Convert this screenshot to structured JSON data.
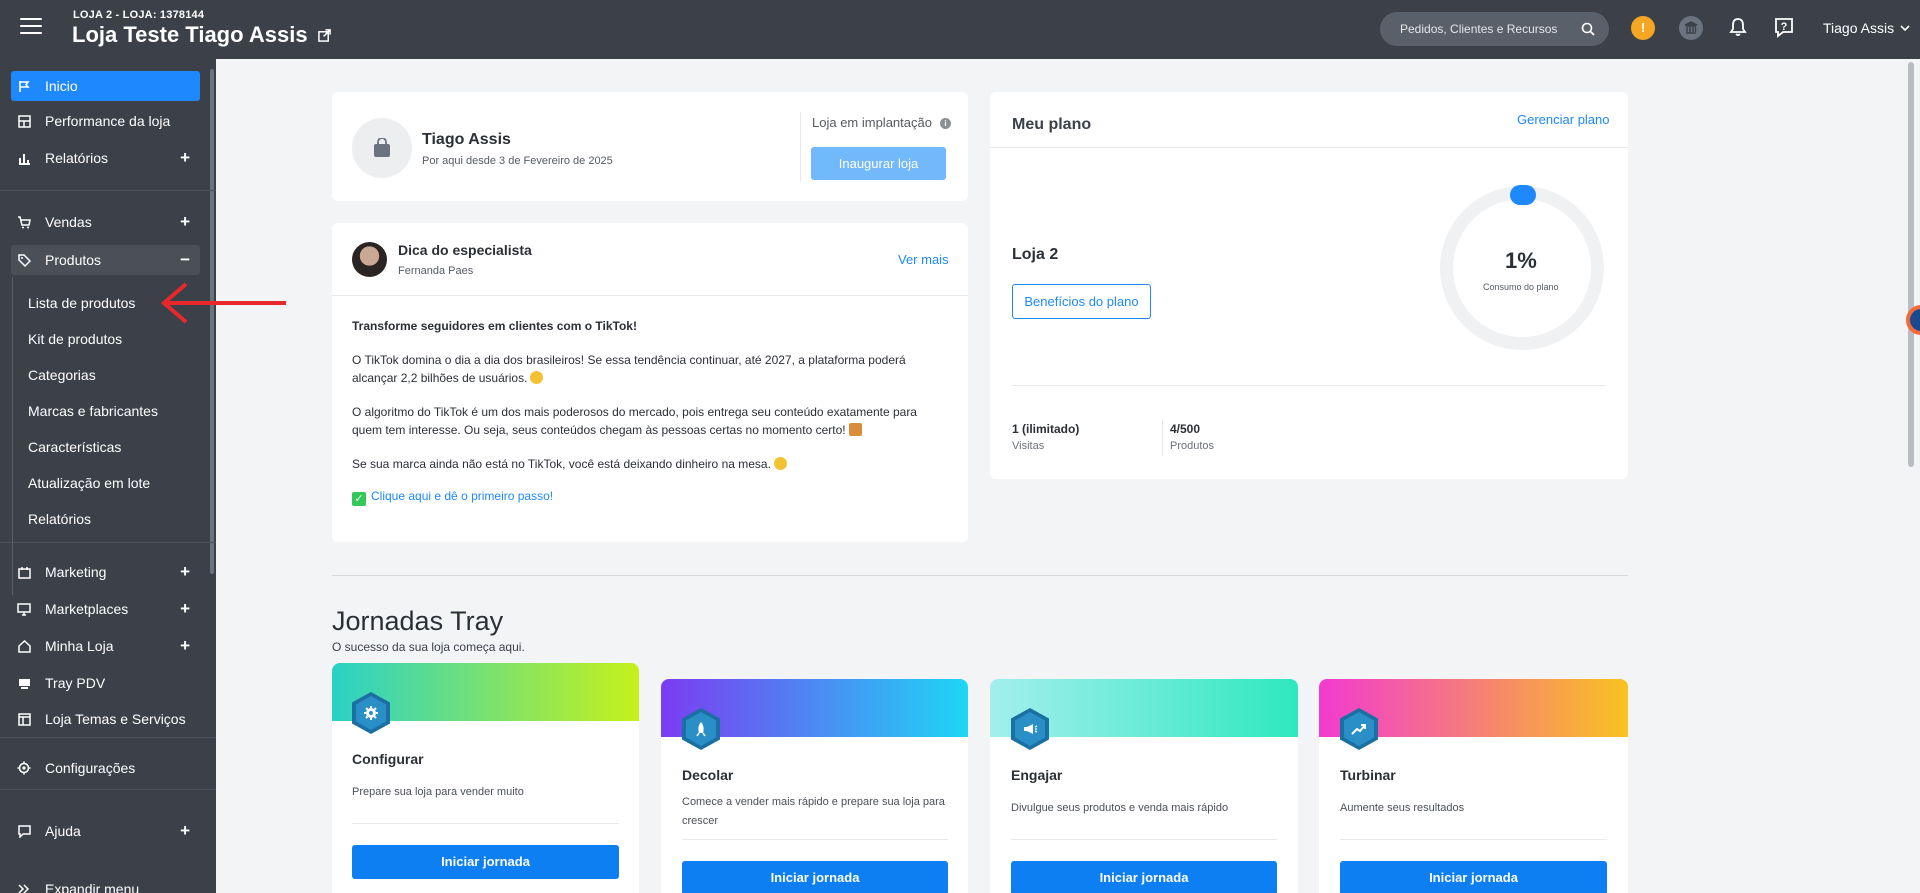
{
  "header": {
    "store_sub": "LOJA 2 - LOJA: 1378144",
    "store_title": "Loja Teste Tiago Assis",
    "search_placeholder": "Pedidos, Clientes e Recursos",
    "alert_label": "!",
    "user_name": "Tiago Assis"
  },
  "sidebar": {
    "items": [
      {
        "label": "Inicio"
      },
      {
        "label": "Performance da loja"
      },
      {
        "label": "Relatórios",
        "expand": "+"
      },
      {
        "label": "Vendas",
        "expand": "+"
      },
      {
        "label": "Produtos",
        "expand": "−"
      },
      {
        "label": "Marketing",
        "expand": "+"
      },
      {
        "label": "Marketplaces",
        "expand": "+"
      },
      {
        "label": "Minha Loja",
        "expand": "+"
      },
      {
        "label": "Tray PDV"
      },
      {
        "label": "Loja Temas e Serviços"
      },
      {
        "label": "Configurações"
      },
      {
        "label": "Ajuda",
        "expand": "+"
      },
      {
        "label": "Expandir menu"
      }
    ],
    "product_subitems": [
      "Lista de produtos",
      "Kit de produtos",
      "Categorias",
      "Marcas e fabricantes",
      "Características",
      "Atualização em lote",
      "Relatórios"
    ]
  },
  "profile_card": {
    "name": "Tiago Assis",
    "since": "Por aqui desde 3 de Fevereiro de 2025",
    "status": "Loja em implantação",
    "info_glyph": "i",
    "button": "Inaugurar loja"
  },
  "tip_card": {
    "title": "Dica do especialista",
    "author": "Fernanda Paes",
    "see_more": "Ver mais",
    "headline": "Transforme seguidores em clientes com o TikTok!",
    "p1": "O TikTok domina o dia a dia dos brasileiros! Se essa tendência continuar, até 2027, a plataforma poderá alcançar 2,2 bilhões de usuários.",
    "p2": "O algoritmo do TikTok é um dos mais poderosos do mercado, pois entrega seu conteúdo exatamente para quem tem interesse. Ou seja, seus conteúdos chegam às pessoas certas no momento certo!",
    "p3": "Se sua marca ainda não está no TikTok, você está deixando dinheiro na mesa.",
    "cta": "Clique aqui e dê o primeiro passo!",
    "check_glyph": "✓"
  },
  "plan_card": {
    "title": "Meu plano",
    "manage": "Gerenciar plano",
    "plan_name": "Loja 2",
    "benefits": "Benefícios do plano",
    "usage_value": "1%",
    "usage_label": "Consumo do plano",
    "usage_fraction": 0.01,
    "visits_value": "1 (ilimitado)",
    "visits_label": "Visitas",
    "products_value": "4/500",
    "products_label": "Produtos"
  },
  "journeys": {
    "title": "Jornadas Tray",
    "subtitle": "O sucesso da sua loja começa aqui.",
    "cards": [
      {
        "title": "Configurar",
        "desc": "Prepare sua loja para vender muito",
        "button": "Iniciar jornada",
        "icon": "gear-icon",
        "gradient": [
          "#2ad1c8",
          "#c6f11a"
        ]
      },
      {
        "title": "Decolar",
        "desc": "Comece a vender mais rápido e prepare sua loja para crescer",
        "button": "Iniciar jornada",
        "icon": "rocket-icon",
        "gradient": [
          "#7b3cf2",
          "#1ed6f4"
        ]
      },
      {
        "title": "Engajar",
        "desc": "Divulgue seus produtos e venda mais rápido",
        "button": "Iniciar jornada",
        "icon": "megaphone-icon",
        "gradient": [
          "#a3eeee",
          "#2fe8c0"
        ]
      },
      {
        "title": "Turbinar",
        "desc": "Aumente seus resultados",
        "button": "Iniciar jornada",
        "icon": "trend-up-icon",
        "gradient": [
          "#f23ad1",
          "#f9c220"
        ]
      }
    ]
  },
  "colors": {
    "accent": "#1e88ff",
    "sidebar": "#3b4049",
    "annotation_arrow": "#e8282b"
  }
}
